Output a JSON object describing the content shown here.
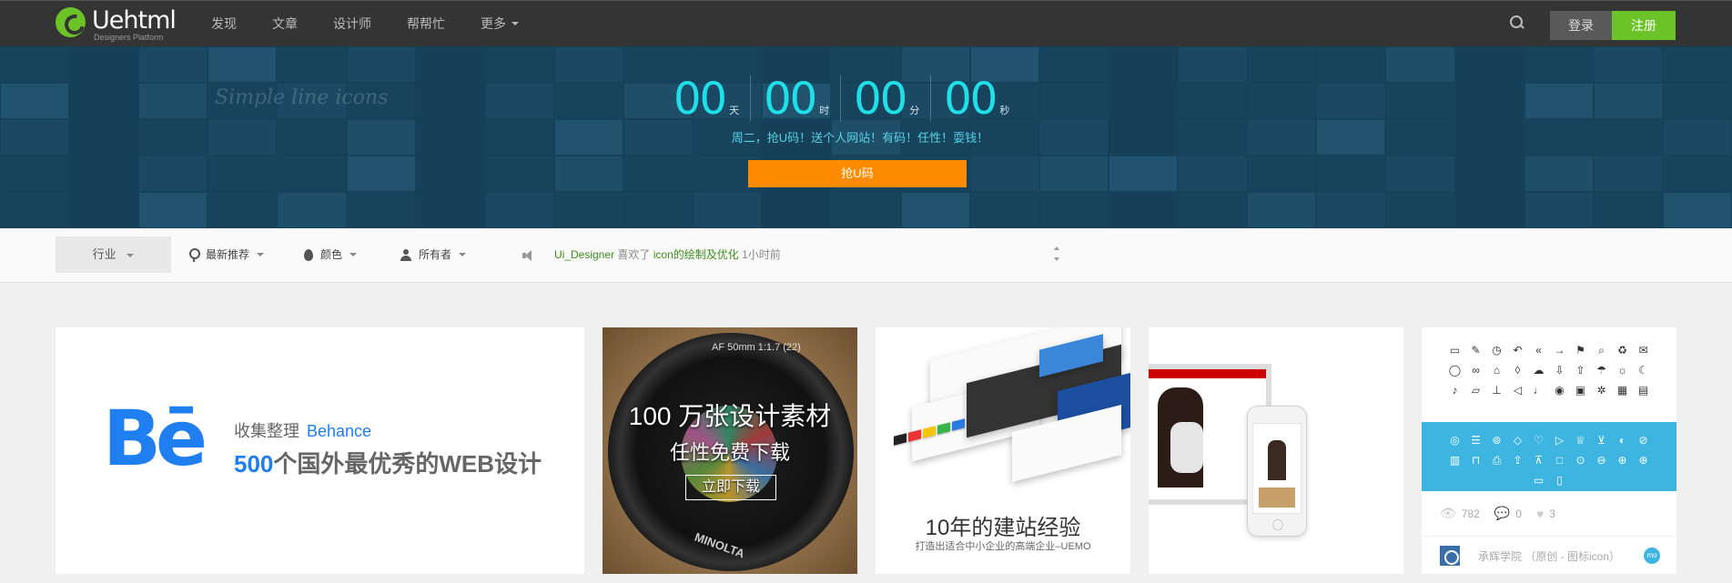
{
  "nav": {
    "logo_text": "Uehtml",
    "logo_sub": "Designers Platform",
    "items": [
      "发现",
      "文章",
      "设计师",
      "帮帮忙",
      "更多"
    ],
    "login": "登录",
    "register": "注册"
  },
  "banner": {
    "script_text": "Simple line icons",
    "countdown": [
      {
        "value": "00",
        "unit": "天"
      },
      {
        "value": "00",
        "unit": "时"
      },
      {
        "value": "00",
        "unit": "分"
      },
      {
        "value": "00",
        "unit": "秒"
      }
    ],
    "subtitle": "周二，抢U码！送个人网站！有码！任性！耍钱！",
    "button": "抢U码"
  },
  "filters": {
    "industry": "行业",
    "recommend": "最新推荐",
    "color": "颜色",
    "owner": "所有者"
  },
  "ticker": {
    "user": "Ui_Designer",
    "action": "喜欢了",
    "target": "icon的绘制及优化",
    "time": "1小时前"
  },
  "cards": {
    "behance": {
      "logo": "Bē",
      "line1_prefix": "收集整理",
      "line1_brand": "Behance",
      "line2_num": "500",
      "line2_text": "个国外最优秀的WEB设计"
    },
    "lens": {
      "rim_text": "AF 50mm 1:1.7 (22)",
      "title": "100 万张设计素材",
      "subtitle": "任性免费下载",
      "button": "立即下载",
      "brand": "MINOLTA"
    },
    "uemo": {
      "title": "10年的建站经验",
      "subtitle": "打造出适合中小企业的高端企业–UEMO"
    },
    "icons": {
      "views": "782",
      "comments": "0",
      "likes": "3",
      "author": "承辉学院 （原创 - 图标icon）",
      "badge": "mo"
    }
  },
  "colors": {
    "brand_green": "#6cc327",
    "accent_orange": "#ff8c00",
    "countdown_cyan": "#1fe0e8",
    "behance_blue": "#1f7ef0",
    "icon_band_blue": "#3db5e0"
  }
}
